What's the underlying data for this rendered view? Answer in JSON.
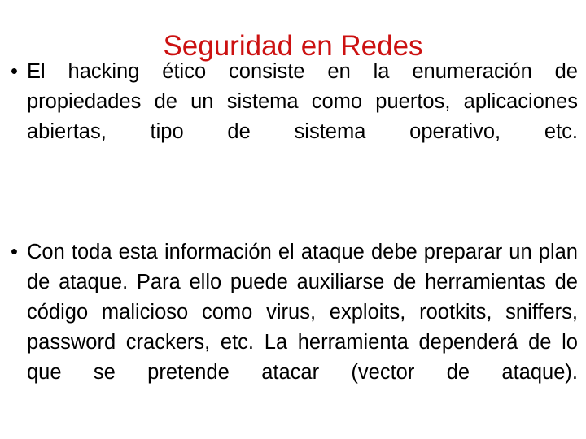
{
  "slide": {
    "background_color": "#ffffff",
    "title": {
      "text": "Seguridad en Redes",
      "color": "#CC1111"
    },
    "body": {
      "text_color": "#000000",
      "bullets": [
        {
          "marker": "•",
          "marker_name": "bullet-dot",
          "text": "El hacking ético consiste en la enumeración de propiedades de un sistema como puertos, aplicaciones abiertas, tipo de sistema operativo, etc."
        },
        {
          "marker": "•",
          "marker_name": "bullet-dot",
          "text": "Con toda esta información el ataque debe preparar un plan de ataque. Para ello puede auxiliarse de herramientas de código malicioso como virus, exploits, rootkits, sniffers, password crackers, etc. La herramienta dependerá de lo que se pretende atacar (vector de ataque)."
        }
      ]
    }
  }
}
